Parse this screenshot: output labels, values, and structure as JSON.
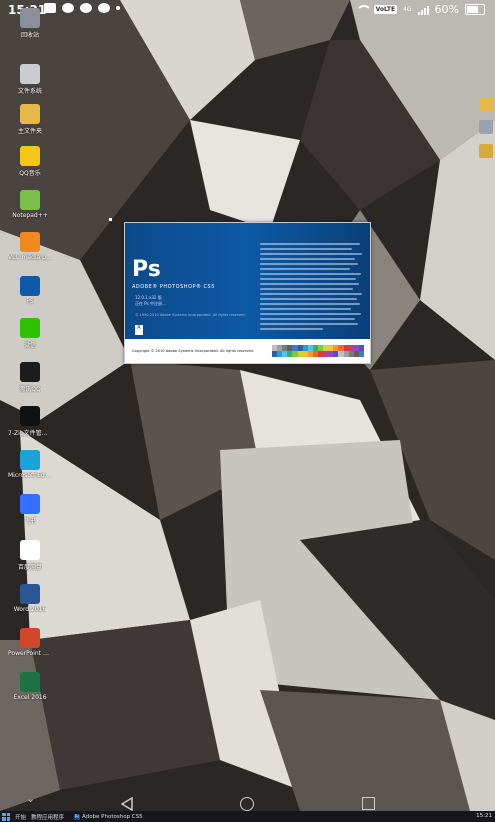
{
  "status_bar": {
    "time": "15:21",
    "volte": "VoLTE",
    "network": "4G",
    "battery": "60%"
  },
  "desktop_icons": [
    {
      "label": "回收站",
      "icon": "recycle-bin-icon",
      "color": "#8a8f99"
    },
    {
      "label": "文件系统",
      "icon": "drive-icon",
      "color": "#c9ccd1"
    },
    {
      "label": "主文件夹",
      "icon": "folder-icon",
      "color": "#e6b84a"
    },
    {
      "label": "QQ音乐",
      "icon": "qq-music-icon",
      "color": "#f5c518"
    },
    {
      "label": "Notepad++",
      "icon": "notepad-icon",
      "color": "#7bbf4a"
    },
    {
      "label": "VLC media player",
      "icon": "vlc-icon",
      "color": "#f08a1c"
    },
    {
      "label": "PS",
      "icon": "photoshop-icon",
      "color": "#0c5aa8"
    },
    {
      "label": "微信",
      "icon": "wechat-icon",
      "color": "#2dc100"
    },
    {
      "label": "腾讯QQ",
      "icon": "qq-icon",
      "color": "#1d1d1d"
    },
    {
      "label": "7-Zip文件管理器",
      "icon": "7zip-icon",
      "color": "#111111"
    },
    {
      "label": "Microsoft Edge",
      "icon": "edge-icon",
      "color": "#1aa2d9"
    },
    {
      "label": "飞书",
      "icon": "feishu-icon",
      "color": "#3370ff"
    },
    {
      "label": "百度网盘",
      "icon": "baidu-netdisk-icon",
      "color": "#ffffff"
    },
    {
      "label": "Word 2016",
      "icon": "word-icon",
      "color": "#2b5797"
    },
    {
      "label": "PowerPoint 2016",
      "icon": "powerpoint-icon",
      "color": "#d24726"
    },
    {
      "label": "Excel 2016",
      "icon": "excel-icon",
      "color": "#1e7145"
    }
  ],
  "splash": {
    "logo": "Ps",
    "product": "ADOBE® PHOTOSHOP® CS5",
    "line1": "12.0.1 x32 版",
    "line2": "正在 Ps 中注册...",
    "legal": "© 1990-2010 Adobe Systems Incorporated. All rights reserved.",
    "adobe_mark": "A",
    "copyright": "Copyright © 2010 Adobe Systems Incorporated. All rights reserved."
  },
  "taskbar": {
    "start_label": "开始",
    "item1": "教程应用程序",
    "item2": "Adobe Photoshop CS5",
    "clock": "15:21"
  },
  "colors": {
    "ps_blue": "#0c4a8a",
    "accent": "#4fa3f7"
  }
}
